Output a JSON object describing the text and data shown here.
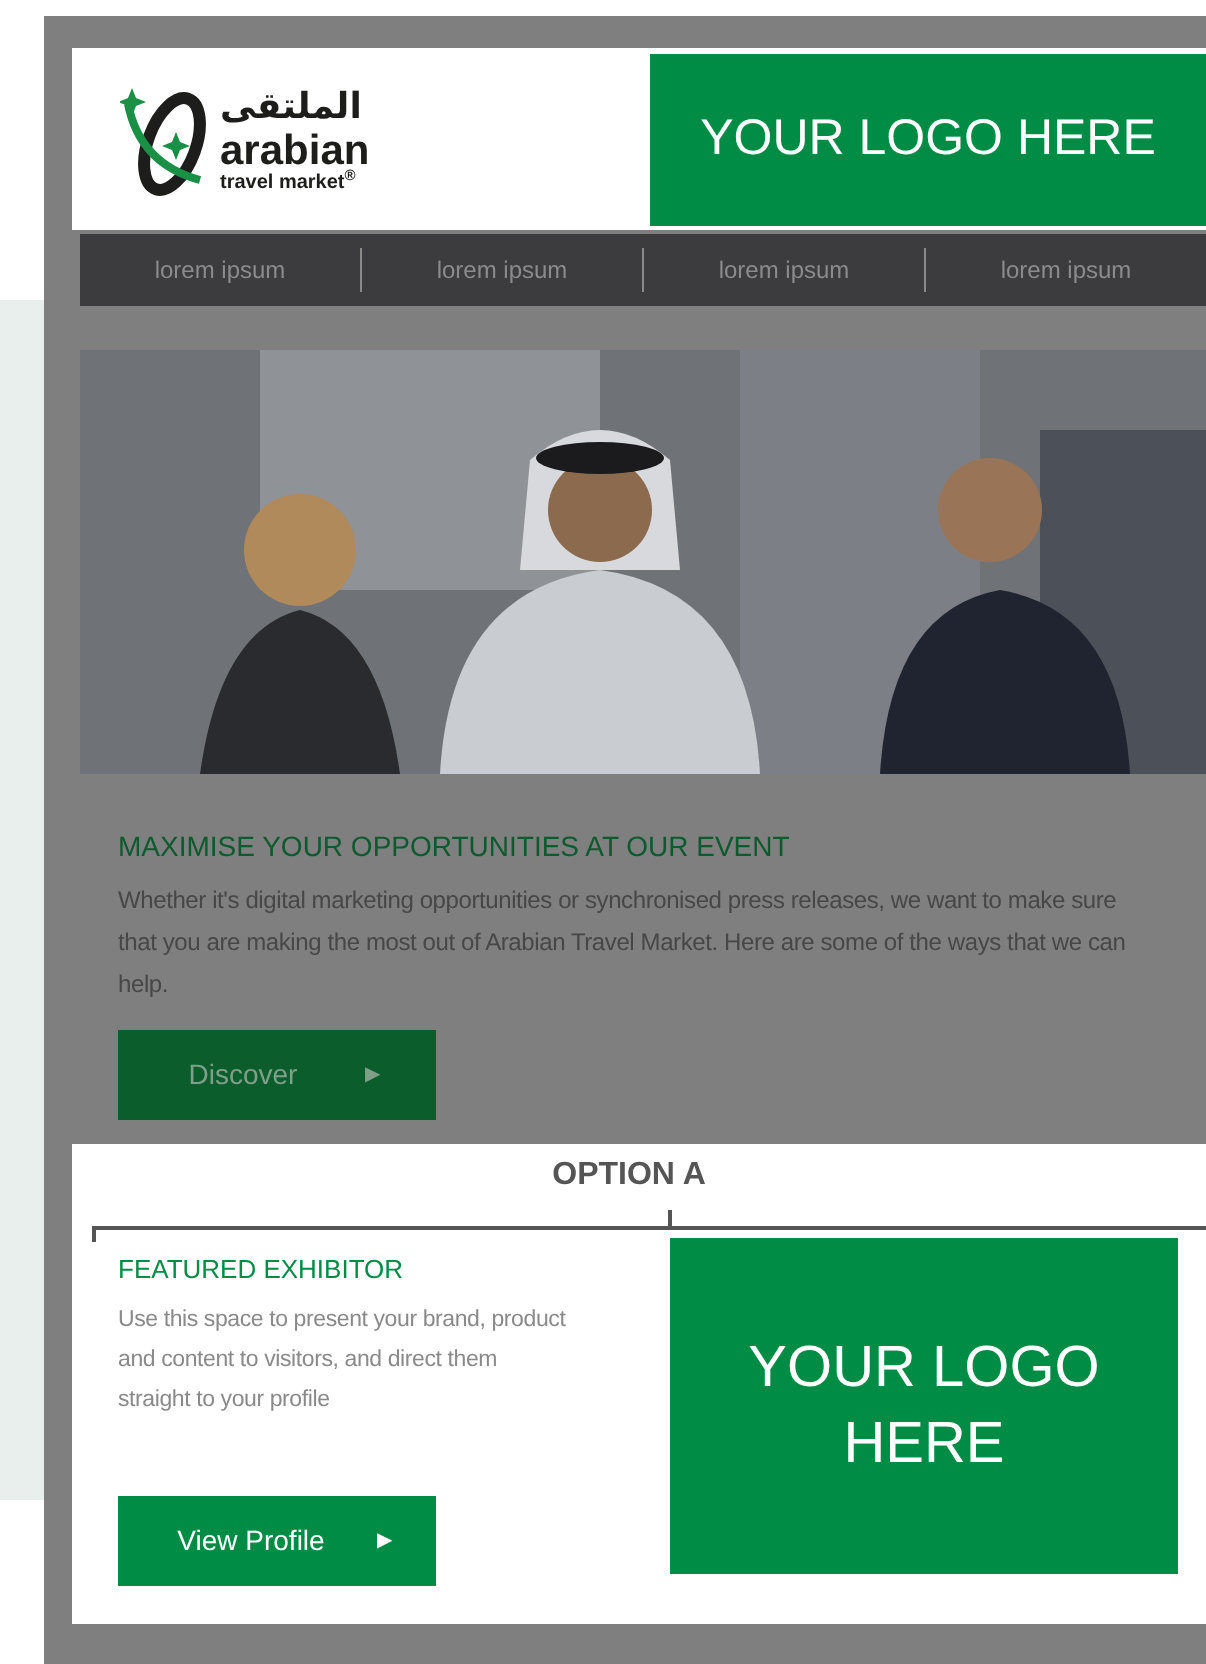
{
  "header": {
    "logo": {
      "arabic": "الملتقى",
      "name": "arabian",
      "tagline": "travel market$^{®}$"
    },
    "logo_placeholder": "YOUR LOGO HERE"
  },
  "nav": [
    {
      "label": "lorem ipsum"
    },
    {
      "label": "lorem ipsum"
    },
    {
      "label": "lorem ipsum"
    },
    {
      "label": "lorem ipsum"
    }
  ],
  "intro": {
    "heading": "MAXIMISE YOUR OPPORTUNITIES AT OUR EVENT",
    "body": "Whether it's digital marketing opportunities or synchronised press releases, we want to make sure that you are making the most out of Arabian Travel Market. Here are some of the ways that we can help.",
    "button": {
      "label": "Discover",
      "arrow": "▶"
    }
  },
  "option": {
    "title": "OPTION A",
    "heading": "FEATURED EXHIBITOR",
    "body": "Use this space to present your brand, product and content to visitors, and direct them straight to your profile",
    "button": {
      "label": "View Profile",
      "arrow": "▶"
    },
    "logo_placeholder": "YOUR LOGO HERE"
  }
}
